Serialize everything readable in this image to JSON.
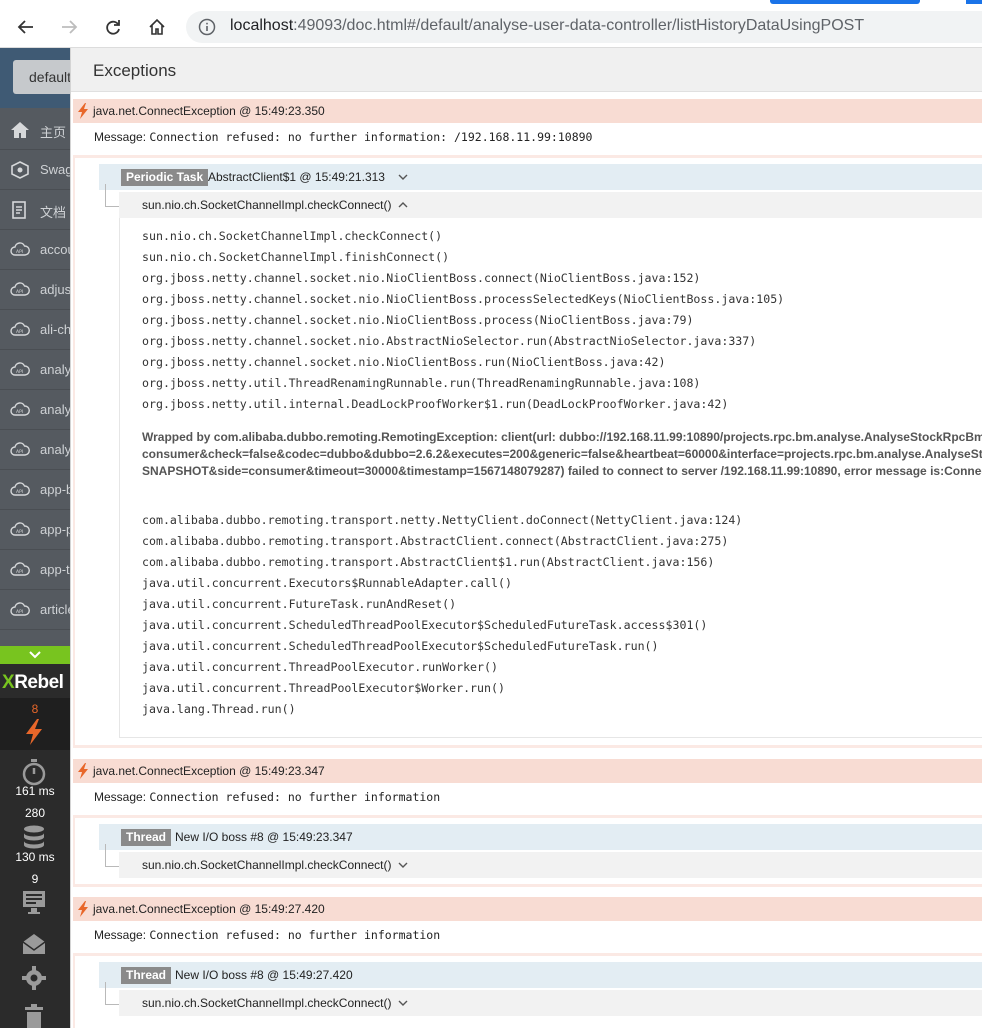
{
  "browser": {
    "url_host": "localhost",
    "url_rest": ":49093/doc.html#/default/analyse-user-data-controller/listHistoryDataUsingPOST"
  },
  "sidebar": {
    "group_select": "default",
    "items": [
      {
        "label": "主页",
        "icon": "home-icon"
      },
      {
        "label": "Swag",
        "icon": "swagger-icon"
      },
      {
        "label": "文档",
        "icon": "document-icon"
      },
      {
        "label": "accou",
        "icon": "api-icon"
      },
      {
        "label": "adjus",
        "icon": "api-icon"
      },
      {
        "label": "ali-ch",
        "icon": "api-icon"
      },
      {
        "label": "analy",
        "icon": "api-icon"
      },
      {
        "label": "analy",
        "icon": "api-icon"
      },
      {
        "label": "analy",
        "icon": "api-icon"
      },
      {
        "label": "app-b",
        "icon": "api-icon"
      },
      {
        "label": "app-p",
        "icon": "api-icon"
      },
      {
        "label": "app-t",
        "icon": "api-icon"
      },
      {
        "label": "article",
        "icon": "api-icon"
      }
    ]
  },
  "xrebel": {
    "logo_x": "X",
    "logo_rest": "Rebel",
    "exceptions_count": "8",
    "time_label": "161 ms",
    "db_count": "280",
    "db_time": "130 ms",
    "io_count": "9"
  },
  "panel": {
    "title": "Exceptions"
  },
  "exceptions": [
    {
      "header": "java.net.ConnectException  @ 15:49:23.350",
      "message_label": "Message: ",
      "message": "Connection refused: no further information: /192.168.11.99:10890",
      "thread_badge": "Periodic Task",
      "thread_name": "AbstractClient$1  @ 15:49:21.313",
      "frame": "sun.nio.ch.SocketChannelImpl.checkConnect()",
      "trace": [
        "sun.nio.ch.SocketChannelImpl.checkConnect()",
        "sun.nio.ch.SocketChannelImpl.finishConnect()",
        "org.jboss.netty.channel.socket.nio.NioClientBoss.connect(NioClientBoss.java:152)",
        "org.jboss.netty.channel.socket.nio.NioClientBoss.processSelectedKeys(NioClientBoss.java:105)",
        "org.jboss.netty.channel.socket.nio.NioClientBoss.process(NioClientBoss.java:79)",
        "org.jboss.netty.channel.socket.nio.AbstractNioSelector.run(AbstractNioSelector.java:337)",
        "org.jboss.netty.channel.socket.nio.NioClientBoss.run(NioClientBoss.java:42)",
        "org.jboss.netty.util.ThreadRenamingRunnable.run(ThreadRenamingRunnable.java:108)",
        "org.jboss.netty.util.internal.DeadLockProofWorker$1.run(DeadLockProofWorker.java:42)"
      ],
      "wrapped": [
        "Wrapped by com.alibaba.dubbo.remoting.RemotingException: client(url: dubbo://192.168.11.99:10890/projects.rpc.bm.analyse.AnalyseStockRpcBm?anyhost=true&application=",
        "consumer&check=false&codec=dubbo&dubbo=2.6.2&executes=200&generic=false&heartbeat=60000&interface=projects.rpc.bm.analyse.AnalyseStockRpcBm&methods=",
        "SNAPSHOT&side=consumer&timeout=30000&timestamp=1567148079287) failed to connect to server /192.168.11.99:10890, error message is:Connection refused"
      ],
      "trace2": [
        "com.alibaba.dubbo.remoting.transport.netty.NettyClient.doConnect(NettyClient.java:124)",
        "com.alibaba.dubbo.remoting.transport.AbstractClient.connect(AbstractClient.java:275)",
        "com.alibaba.dubbo.remoting.transport.AbstractClient$1.run(AbstractClient.java:156)",
        "java.util.concurrent.Executors$RunnableAdapter.call()",
        "java.util.concurrent.FutureTask.runAndReset()",
        "java.util.concurrent.ScheduledThreadPoolExecutor$ScheduledFutureTask.access$301()",
        "java.util.concurrent.ScheduledThreadPoolExecutor$ScheduledFutureTask.run()",
        "java.util.concurrent.ThreadPoolExecutor.runWorker()",
        "java.util.concurrent.ThreadPoolExecutor$Worker.run()",
        "java.lang.Thread.run()"
      ]
    },
    {
      "header": "java.net.ConnectException  @ 15:49:23.347",
      "message_label": "Message: ",
      "message": "Connection refused: no further information",
      "thread_badge": "Thread",
      "thread_name": "New I/O boss #8  @ 15:49:23.347",
      "frame": "sun.nio.ch.SocketChannelImpl.checkConnect()"
    },
    {
      "header": "java.net.ConnectException  @ 15:49:27.420",
      "message_label": "Message: ",
      "message": "Connection refused: no further information",
      "thread_badge": "Thread",
      "thread_name": "New I/O boss #8  @ 15:49:27.420",
      "frame": "sun.nio.ch.SocketChannelImpl.checkConnect()"
    }
  ],
  "colors": {
    "exception_header": "#f8dcd3",
    "thread_row": "#e3edf3",
    "xrebel_green": "#78c41f",
    "bolt_orange": "#e8672a"
  }
}
